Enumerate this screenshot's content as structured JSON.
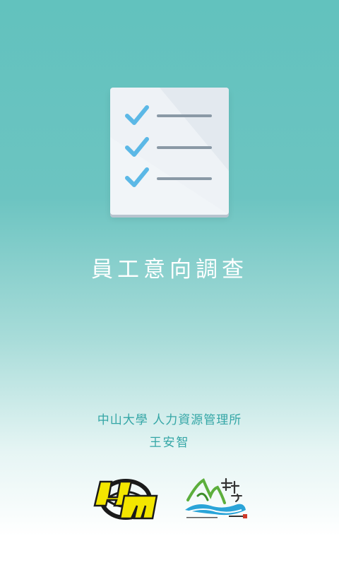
{
  "app": {
    "title": "員工意向調查",
    "department": "中山大學 人力資源管理所",
    "author": "王安智"
  },
  "icons": {
    "hero": "checklist-icon",
    "logo_left": "hrm-logo",
    "logo_right": "nsysu-logo"
  },
  "colors": {
    "background_top": "#62c2be",
    "background_bottom": "#ffffff",
    "check": "#5bb8e6",
    "line": "#8a99a6",
    "text_accent": "#34a6a6",
    "logo_yellow": "#f3e600"
  }
}
